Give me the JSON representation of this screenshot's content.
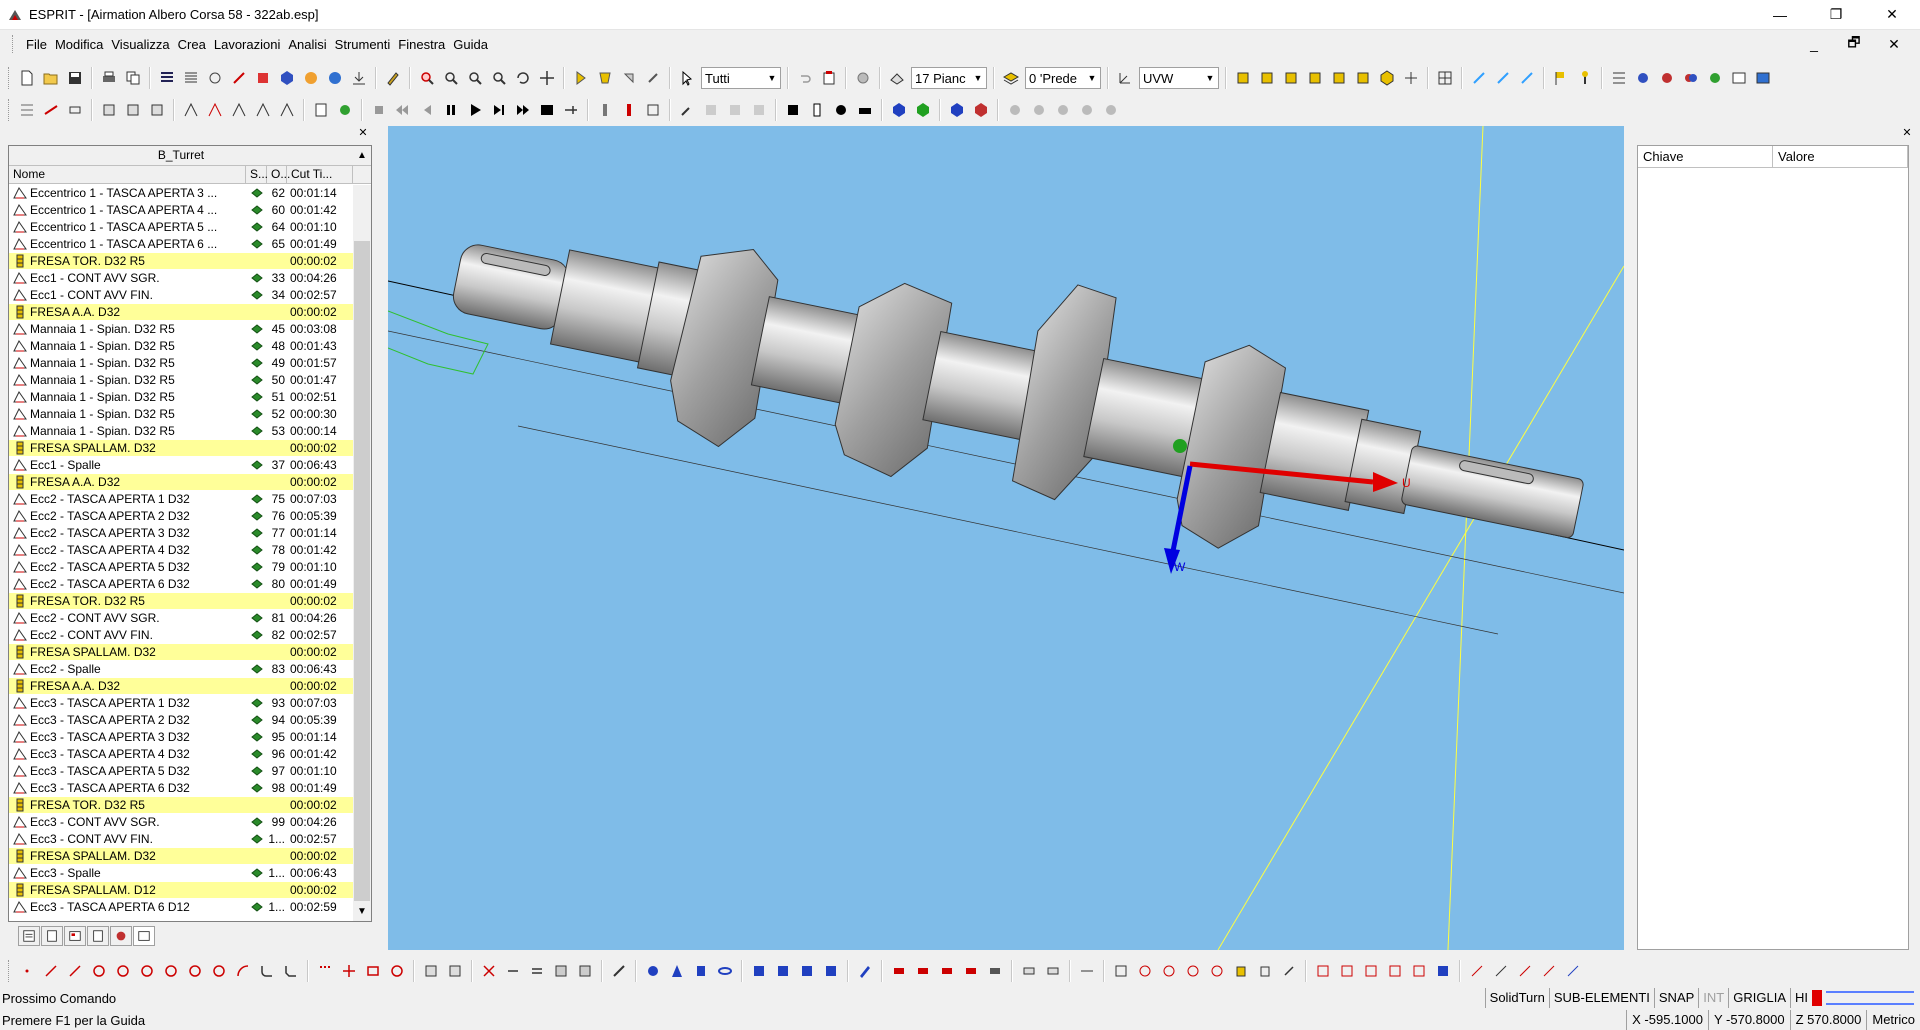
{
  "window": {
    "title": "ESPRIT - [Airmation Albero Corsa 58 - 322ab.esp]",
    "minimize": "—",
    "maximize": "❐",
    "close": "✕"
  },
  "menu": {
    "items": [
      "File",
      "Modifica",
      "Visualizza",
      "Crea",
      "Lavorazioni",
      "Analisi",
      "Strumenti",
      "Finestra",
      "Guida"
    ],
    "mdi_min": "_",
    "mdi_restore": "🗗",
    "mdi_close": "✕"
  },
  "toolbar": {
    "filter_combo": "Tutti",
    "work_plane_combo": "17 Pianc",
    "layer_combo": "0 'Prede",
    "coord_combo": "UVW"
  },
  "tree": {
    "header": "B_Turret",
    "col_name": "Nome",
    "col_s": "S...",
    "col_o": "O...",
    "col_time": "Cut Ti...",
    "rows": [
      {
        "type": "op",
        "name": "Eccentrico 1 - TASCA APERTA 3 ...",
        "o": "62",
        "t": "00:01:14"
      },
      {
        "type": "op",
        "name": "Eccentrico 1 - TASCA APERTA 4 ...",
        "o": "60",
        "t": "00:01:42"
      },
      {
        "type": "op",
        "name": "Eccentrico 1 - TASCA APERTA 5 ...",
        "o": "64",
        "t": "00:01:10"
      },
      {
        "type": "op",
        "name": "Eccentrico 1 - TASCA APERTA 6 ...",
        "o": "65",
        "t": "00:01:49"
      },
      {
        "type": "tool",
        "name": "FRESA TOR. D32 R5",
        "o": "",
        "t": "00:00:02"
      },
      {
        "type": "op",
        "name": "Ecc1 - CONT AVV SGR.",
        "o": "33",
        "t": "00:04:26"
      },
      {
        "type": "op",
        "name": "Ecc1 - CONT AVV FIN.",
        "o": "34",
        "t": "00:02:57"
      },
      {
        "type": "tool",
        "name": "FRESA A.A. D32",
        "o": "",
        "t": "00:00:02"
      },
      {
        "type": "op",
        "name": "Mannaia 1 - Spian. D32 R5",
        "o": "45",
        "t": "00:03:08"
      },
      {
        "type": "op",
        "name": "Mannaia 1 - Spian. D32 R5",
        "o": "48",
        "t": "00:01:43"
      },
      {
        "type": "op",
        "name": "Mannaia 1 - Spian. D32 R5",
        "o": "49",
        "t": "00:01:57"
      },
      {
        "type": "op",
        "name": "Mannaia 1 - Spian. D32 R5",
        "o": "50",
        "t": "00:01:47"
      },
      {
        "type": "op",
        "name": "Mannaia 1 - Spian. D32 R5",
        "o": "51",
        "t": "00:02:51"
      },
      {
        "type": "op",
        "name": "Mannaia 1 - Spian. D32 R5",
        "o": "52",
        "t": "00:00:30"
      },
      {
        "type": "op",
        "name": "Mannaia 1 - Spian. D32 R5",
        "o": "53",
        "t": "00:00:14"
      },
      {
        "type": "tool",
        "name": "FRESA SPALLAM. D32",
        "o": "",
        "t": "00:00:02"
      },
      {
        "type": "op",
        "name": "Ecc1 - Spalle",
        "o": "37",
        "t": "00:06:43"
      },
      {
        "type": "tool",
        "name": "FRESA A.A. D32",
        "o": "",
        "t": "00:00:02"
      },
      {
        "type": "op",
        "name": "Ecc2 - TASCA APERTA 1 D32",
        "o": "75",
        "t": "00:07:03"
      },
      {
        "type": "op",
        "name": "Ecc2 - TASCA APERTA 2 D32",
        "o": "76",
        "t": "00:05:39"
      },
      {
        "type": "op",
        "name": "Ecc2 - TASCA APERTA 3 D32",
        "o": "77",
        "t": "00:01:14"
      },
      {
        "type": "op",
        "name": "Ecc2 - TASCA APERTA 4 D32",
        "o": "78",
        "t": "00:01:42"
      },
      {
        "type": "op",
        "name": "Ecc2 - TASCA APERTA 5 D32",
        "o": "79",
        "t": "00:01:10"
      },
      {
        "type": "op",
        "name": "Ecc2 - TASCA APERTA 6 D32",
        "o": "80",
        "t": "00:01:49"
      },
      {
        "type": "tool",
        "name": "FRESA TOR. D32 R5",
        "o": "",
        "t": "00:00:02"
      },
      {
        "type": "op",
        "name": "Ecc2 - CONT AVV SGR.",
        "o": "81",
        "t": "00:04:26"
      },
      {
        "type": "op",
        "name": "Ecc2 - CONT AVV FIN.",
        "o": "82",
        "t": "00:02:57"
      },
      {
        "type": "tool",
        "name": "FRESA SPALLAM. D32",
        "o": "",
        "t": "00:00:02"
      },
      {
        "type": "op",
        "name": "Ecc2 - Spalle",
        "o": "83",
        "t": "00:06:43"
      },
      {
        "type": "tool",
        "name": "FRESA A.A. D32",
        "o": "",
        "t": "00:00:02"
      },
      {
        "type": "op",
        "name": "Ecc3 - TASCA APERTA 1 D32",
        "o": "93",
        "t": "00:07:03"
      },
      {
        "type": "op",
        "name": "Ecc3 - TASCA APERTA 2 D32",
        "o": "94",
        "t": "00:05:39"
      },
      {
        "type": "op",
        "name": "Ecc3 - TASCA APERTA 3 D32",
        "o": "95",
        "t": "00:01:14"
      },
      {
        "type": "op",
        "name": "Ecc3 - TASCA APERTA 4 D32",
        "o": "96",
        "t": "00:01:42"
      },
      {
        "type": "op",
        "name": "Ecc3 - TASCA APERTA 5 D32",
        "o": "97",
        "t": "00:01:10"
      },
      {
        "type": "op",
        "name": "Ecc3 - TASCA APERTA 6 D32",
        "o": "98",
        "t": "00:01:49"
      },
      {
        "type": "tool",
        "name": "FRESA TOR. D32 R5",
        "o": "",
        "t": "00:00:02"
      },
      {
        "type": "op",
        "name": "Ecc3 - CONT AVV SGR.",
        "o": "99",
        "t": "00:04:26"
      },
      {
        "type": "op",
        "name": "Ecc3 - CONT AVV FIN.",
        "o": "1...",
        "t": "00:02:57"
      },
      {
        "type": "tool",
        "name": "FRESA SPALLAM. D32",
        "o": "",
        "t": "00:00:02"
      },
      {
        "type": "op",
        "name": "Ecc3 - Spalle",
        "o": "1...",
        "t": "00:06:43"
      },
      {
        "type": "tool",
        "name": "FRESA SPALLAM. D12",
        "o": "",
        "t": "00:00:02"
      },
      {
        "type": "op",
        "name": "Ecc3 - TASCA APERTA 6 D12",
        "o": "1...",
        "t": "00:02:59"
      }
    ]
  },
  "viewport": {
    "axis_u": "U",
    "axis_w": "W",
    "colors": {
      "background": "#7fbce8",
      "axis_u": "#e00000",
      "axis_w": "#0000e0",
      "guide": "#ffff40"
    }
  },
  "properties": {
    "col_key": "Chiave",
    "col_value": "Valore"
  },
  "status": {
    "command": "Prossimo Comando",
    "help": "Premere F1 per la Guida",
    "mode": "SolidTurn",
    "sub_elements": "SUB-ELEMENTI",
    "snap": "SNAP",
    "int": "INT",
    "grid": "GRIGLIA",
    "hi": "HI",
    "x": "X -595.1000",
    "y": "Y -570.8000",
    "z": "Z 570.8000",
    "units": "Metrico"
  }
}
